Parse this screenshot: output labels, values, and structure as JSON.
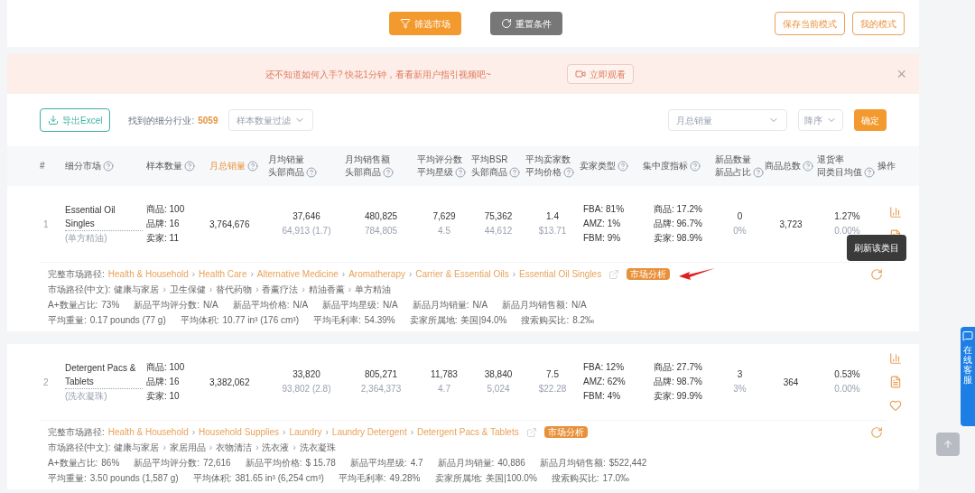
{
  "top_buttons": [
    {
      "label": "筛选市场",
      "kind": "primary"
    },
    {
      "label": "重置条件",
      "kind": "secondary"
    }
  ],
  "mode_buttons": [
    "保存当前模式",
    "我的模式"
  ],
  "banner": {
    "text": "还不知道如何入手? 快花1分钟，看看新用户指引视频吧~",
    "button": "立即观看",
    "close": "×"
  },
  "toolbar": {
    "export": "导出Excel",
    "found_label": "找到的细分行业:",
    "found_count": "5059",
    "filter_placeholder": "样本数量过滤",
    "sort_field": "月总销量",
    "sort_order": "降序",
    "confirm": "确定"
  },
  "columns": [
    {
      "lines": [
        "#"
      ],
      "help": false,
      "selected": false
    },
    {
      "lines": [
        "细分市场"
      ],
      "help": true,
      "selected": false
    },
    {
      "lines": [
        "样本数量"
      ],
      "help": true,
      "selected": false
    },
    {
      "lines": [
        "月总销量"
      ],
      "help": true,
      "selected": true
    },
    {
      "lines": [
        "月均销量",
        "头部商品"
      ],
      "help": true,
      "selected": false
    },
    {
      "lines": [
        "月均销售额",
        "头部商品"
      ],
      "help": true,
      "selected": false
    },
    {
      "lines": [
        "平均评分数",
        "平均星级"
      ],
      "help": true,
      "selected": false
    },
    {
      "lines": [
        "平均BSR",
        "头部商品"
      ],
      "help": true,
      "selected": false
    },
    {
      "lines": [
        "平均卖家数",
        "平均价格"
      ],
      "help": true,
      "selected": false
    },
    {
      "lines": [
        "卖家类型"
      ],
      "help": true,
      "selected": false
    },
    {
      "lines": [
        "集中度指标"
      ],
      "help": true,
      "selected": false
    },
    {
      "lines": [
        "新品数量",
        "新品占比"
      ],
      "help": true,
      "selected": false
    },
    {
      "lines": [
        "商品总数"
      ],
      "help": true,
      "selected": false
    },
    {
      "lines": [
        "退货率",
        "同类目均值"
      ],
      "help": true,
      "selected": false
    },
    {
      "lines": [
        "操作"
      ],
      "help": false,
      "selected": false
    }
  ],
  "rows": [
    {
      "index": "1",
      "name": "Essential Oil Singles",
      "name_cn": "(单方精油)",
      "sample": [
        "商品: 100",
        "品牌: 16",
        "卖家: 11"
      ],
      "monthly_total": "3,764,676",
      "pairs": [
        {
          "main": "37,646",
          "sub": "64,913 (1.7)"
        },
        {
          "main": "480,825",
          "sub": "784,805"
        },
        {
          "main": "7,629",
          "sub": "4.5"
        },
        {
          "main": "75,362",
          "sub": "44,612"
        },
        {
          "main": "1.4",
          "sub": "$13.71"
        }
      ],
      "seller_types": [
        "FBA: 81%",
        "AMZ: 1%",
        "FBM: 9%"
      ],
      "concentration": [
        "商品: 17.2%",
        "品牌: 96.7%",
        "卖家: 98.9%"
      ],
      "new": {
        "main": "0",
        "sub": "0%"
      },
      "total_products": "3,723",
      "returns": {
        "main": "1.27%",
        "sub": "0.00%"
      },
      "actions": [
        {
          "kind": "chart"
        },
        {
          "kind": "report"
        }
      ],
      "tooltip": "刷新该类目",
      "annotated": true,
      "separator": "›",
      "path_label": "完整市场路径:",
      "path": [
        "Health & Household",
        "Health Care",
        "Alternative Medicine",
        "Aromatherapy",
        "Carrier & Essential Oils",
        "Essential Oil Singles"
      ],
      "badge": "市场分析",
      "path_cn_label": "市场路径(中文):",
      "path_cn": [
        "健康与家居",
        "卫生保健",
        "替代药物",
        "香薰疗法",
        "精油香薰",
        "单方精油"
      ],
      "stats": [
        [
          {
            "label": "A+数量占比:",
            "value": "73%"
          },
          {
            "label": "新品平均评分数:",
            "value": "N/A"
          },
          {
            "label": "新品平均价格:",
            "value": "N/A"
          },
          {
            "label": "新品平均星级:",
            "value": "N/A"
          },
          {
            "label": "新品月均销量:",
            "value": "N/A"
          },
          {
            "label": "新品月均销售额:",
            "value": "N/A"
          }
        ],
        [
          {
            "label": "平均重量:",
            "value": "0.17 pounds (77 g)"
          },
          {
            "label": "平均体积:",
            "value": "10.77 in³ (176 cm³)"
          },
          {
            "label": "平均毛利率:",
            "value": "54.39%"
          },
          {
            "label": "卖家所属地:",
            "value": "美国|94.0%"
          },
          {
            "label": "搜索购买比:",
            "value": "8.2‰"
          }
        ]
      ]
    },
    {
      "index": "2",
      "name": "Detergent Pacs & Tablets",
      "name_cn": "(洗衣凝珠)",
      "sample": [
        "商品: 100",
        "品牌: 16",
        "卖家: 10"
      ],
      "monthly_total": "3,382,062",
      "pairs": [
        {
          "main": "33,820",
          "sub": "93,802 (2.8)"
        },
        {
          "main": "805,271",
          "sub": "2,364,373"
        },
        {
          "main": "11,783",
          "sub": "4.7"
        },
        {
          "main": "38,840",
          "sub": "5,024"
        },
        {
          "main": "7.5",
          "sub": "$22.28"
        }
      ],
      "seller_types": [
        "FBA: 12%",
        "AMZ: 62%",
        "FBM: 4%"
      ],
      "concentration": [
        "商品: 27.7%",
        "品牌: 98.7%",
        "卖家: 99.9%"
      ],
      "new": {
        "main": "3",
        "sub": "3%"
      },
      "total_products": "364",
      "returns": {
        "main": "0.53%",
        "sub": "0.00%"
      },
      "actions": [
        {
          "kind": "chart"
        },
        {
          "kind": "report"
        },
        {
          "kind": "favorite"
        }
      ],
      "annotated": false,
      "separator": "›",
      "path_label": "完整市场路径:",
      "path": [
        "Health & Household",
        "Household Supplies",
        "Laundry",
        "Laundry Detergent",
        "Detergent Pacs & Tablets"
      ],
      "badge": "市场分析",
      "path_cn_label": "市场路径(中文):",
      "path_cn": [
        "健康与家居",
        "家居用品",
        "衣物清洁",
        "洗衣液",
        "洗衣凝珠"
      ],
      "stats": [
        [
          {
            "label": "A+数量占比:",
            "value": "86%"
          },
          {
            "label": "新品平均评分数:",
            "value": "72,616"
          },
          {
            "label": "新品平均价格:",
            "value": "$ 15.78"
          },
          {
            "label": "新品平均星级:",
            "value": "4.7"
          },
          {
            "label": "新品月均销量:",
            "value": "40,886"
          },
          {
            "label": "新品月均销售额:",
            "value": "$522,442"
          }
        ],
        [
          {
            "label": "平均重量:",
            "value": "3.50 pounds (1,587 g)"
          },
          {
            "label": "平均体积:",
            "value": "381.65 in³ (6,254 cm³)"
          },
          {
            "label": "平均毛利率:",
            "value": "49.28%"
          },
          {
            "label": "卖家所属地:",
            "value": "美国|100.0%"
          },
          {
            "label": "搜索购买比:",
            "value": "17.0‰"
          }
        ]
      ]
    }
  ],
  "side_tab": "在线客服"
}
